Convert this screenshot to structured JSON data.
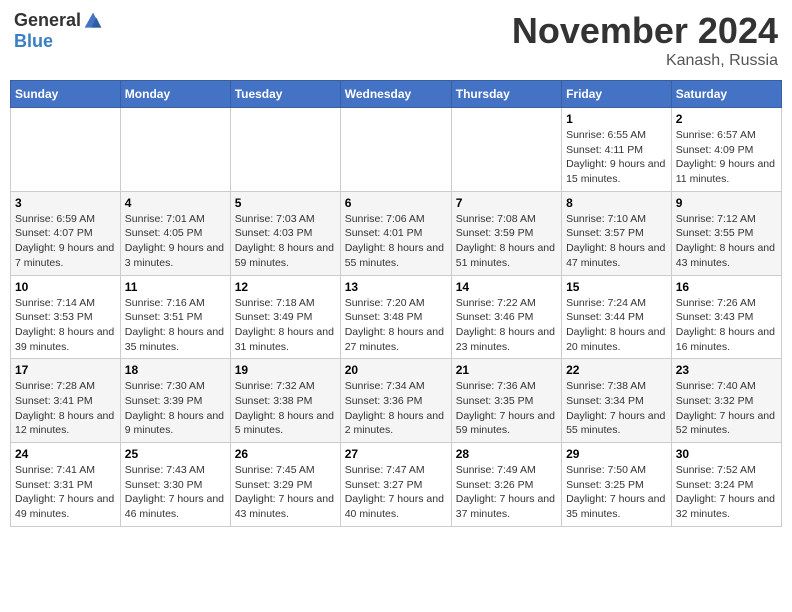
{
  "header": {
    "logo_general": "General",
    "logo_blue": "Blue",
    "month_title": "November 2024",
    "location": "Kanash, Russia"
  },
  "weekdays": [
    "Sunday",
    "Monday",
    "Tuesday",
    "Wednesday",
    "Thursday",
    "Friday",
    "Saturday"
  ],
  "weeks": [
    [
      {
        "day": "",
        "info": ""
      },
      {
        "day": "",
        "info": ""
      },
      {
        "day": "",
        "info": ""
      },
      {
        "day": "",
        "info": ""
      },
      {
        "day": "",
        "info": ""
      },
      {
        "day": "1",
        "info": "Sunrise: 6:55 AM\nSunset: 4:11 PM\nDaylight: 9 hours and 15 minutes."
      },
      {
        "day": "2",
        "info": "Sunrise: 6:57 AM\nSunset: 4:09 PM\nDaylight: 9 hours and 11 minutes."
      }
    ],
    [
      {
        "day": "3",
        "info": "Sunrise: 6:59 AM\nSunset: 4:07 PM\nDaylight: 9 hours and 7 minutes."
      },
      {
        "day": "4",
        "info": "Sunrise: 7:01 AM\nSunset: 4:05 PM\nDaylight: 9 hours and 3 minutes."
      },
      {
        "day": "5",
        "info": "Sunrise: 7:03 AM\nSunset: 4:03 PM\nDaylight: 8 hours and 59 minutes."
      },
      {
        "day": "6",
        "info": "Sunrise: 7:06 AM\nSunset: 4:01 PM\nDaylight: 8 hours and 55 minutes."
      },
      {
        "day": "7",
        "info": "Sunrise: 7:08 AM\nSunset: 3:59 PM\nDaylight: 8 hours and 51 minutes."
      },
      {
        "day": "8",
        "info": "Sunrise: 7:10 AM\nSunset: 3:57 PM\nDaylight: 8 hours and 47 minutes."
      },
      {
        "day": "9",
        "info": "Sunrise: 7:12 AM\nSunset: 3:55 PM\nDaylight: 8 hours and 43 minutes."
      }
    ],
    [
      {
        "day": "10",
        "info": "Sunrise: 7:14 AM\nSunset: 3:53 PM\nDaylight: 8 hours and 39 minutes."
      },
      {
        "day": "11",
        "info": "Sunrise: 7:16 AM\nSunset: 3:51 PM\nDaylight: 8 hours and 35 minutes."
      },
      {
        "day": "12",
        "info": "Sunrise: 7:18 AM\nSunset: 3:49 PM\nDaylight: 8 hours and 31 minutes."
      },
      {
        "day": "13",
        "info": "Sunrise: 7:20 AM\nSunset: 3:48 PM\nDaylight: 8 hours and 27 minutes."
      },
      {
        "day": "14",
        "info": "Sunrise: 7:22 AM\nSunset: 3:46 PM\nDaylight: 8 hours and 23 minutes."
      },
      {
        "day": "15",
        "info": "Sunrise: 7:24 AM\nSunset: 3:44 PM\nDaylight: 8 hours and 20 minutes."
      },
      {
        "day": "16",
        "info": "Sunrise: 7:26 AM\nSunset: 3:43 PM\nDaylight: 8 hours and 16 minutes."
      }
    ],
    [
      {
        "day": "17",
        "info": "Sunrise: 7:28 AM\nSunset: 3:41 PM\nDaylight: 8 hours and 12 minutes."
      },
      {
        "day": "18",
        "info": "Sunrise: 7:30 AM\nSunset: 3:39 PM\nDaylight: 8 hours and 9 minutes."
      },
      {
        "day": "19",
        "info": "Sunrise: 7:32 AM\nSunset: 3:38 PM\nDaylight: 8 hours and 5 minutes."
      },
      {
        "day": "20",
        "info": "Sunrise: 7:34 AM\nSunset: 3:36 PM\nDaylight: 8 hours and 2 minutes."
      },
      {
        "day": "21",
        "info": "Sunrise: 7:36 AM\nSunset: 3:35 PM\nDaylight: 7 hours and 59 minutes."
      },
      {
        "day": "22",
        "info": "Sunrise: 7:38 AM\nSunset: 3:34 PM\nDaylight: 7 hours and 55 minutes."
      },
      {
        "day": "23",
        "info": "Sunrise: 7:40 AM\nSunset: 3:32 PM\nDaylight: 7 hours and 52 minutes."
      }
    ],
    [
      {
        "day": "24",
        "info": "Sunrise: 7:41 AM\nSunset: 3:31 PM\nDaylight: 7 hours and 49 minutes."
      },
      {
        "day": "25",
        "info": "Sunrise: 7:43 AM\nSunset: 3:30 PM\nDaylight: 7 hours and 46 minutes."
      },
      {
        "day": "26",
        "info": "Sunrise: 7:45 AM\nSunset: 3:29 PM\nDaylight: 7 hours and 43 minutes."
      },
      {
        "day": "27",
        "info": "Sunrise: 7:47 AM\nSunset: 3:27 PM\nDaylight: 7 hours and 40 minutes."
      },
      {
        "day": "28",
        "info": "Sunrise: 7:49 AM\nSunset: 3:26 PM\nDaylight: 7 hours and 37 minutes."
      },
      {
        "day": "29",
        "info": "Sunrise: 7:50 AM\nSunset: 3:25 PM\nDaylight: 7 hours and 35 minutes."
      },
      {
        "day": "30",
        "info": "Sunrise: 7:52 AM\nSunset: 3:24 PM\nDaylight: 7 hours and 32 minutes."
      }
    ]
  ]
}
